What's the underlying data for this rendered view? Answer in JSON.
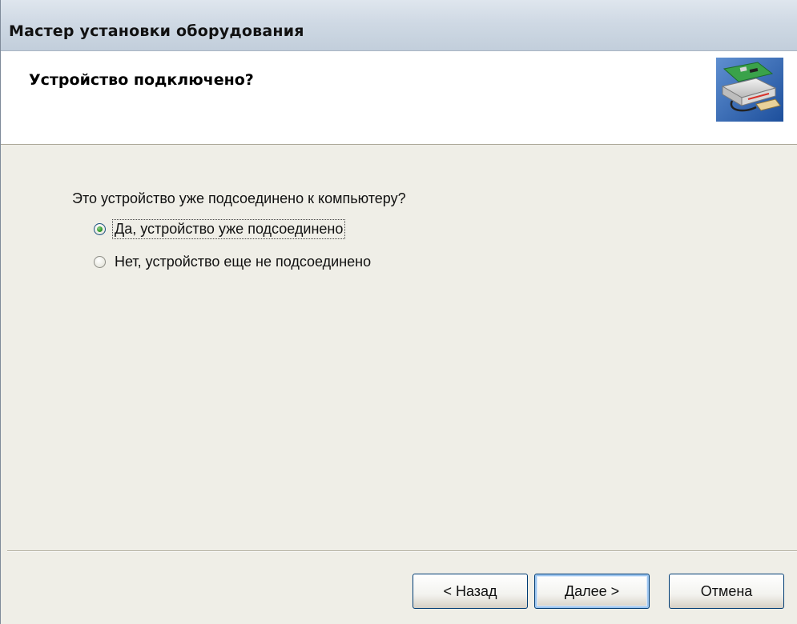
{
  "window": {
    "title": "Мастер установки оборудования"
  },
  "header": {
    "heading": "Устройство подключено?",
    "icon": "hardware-wizard-icon"
  },
  "main": {
    "question": "Это устройство уже подсоединено к компьютеру?",
    "options": [
      {
        "label": "Да, устройство уже подсоединено",
        "selected": true
      },
      {
        "label": "Нет, устройство еще не подсоединено",
        "selected": false
      }
    ]
  },
  "buttons": {
    "back_label": "< Назад",
    "next_label": "Далее >",
    "cancel_label": "Отмена"
  },
  "colors": {
    "dialog_bg": "#efeee7",
    "header_bg": "#ffffff",
    "radio_selected": "#2f9a2a",
    "button_border": "#003c74"
  }
}
